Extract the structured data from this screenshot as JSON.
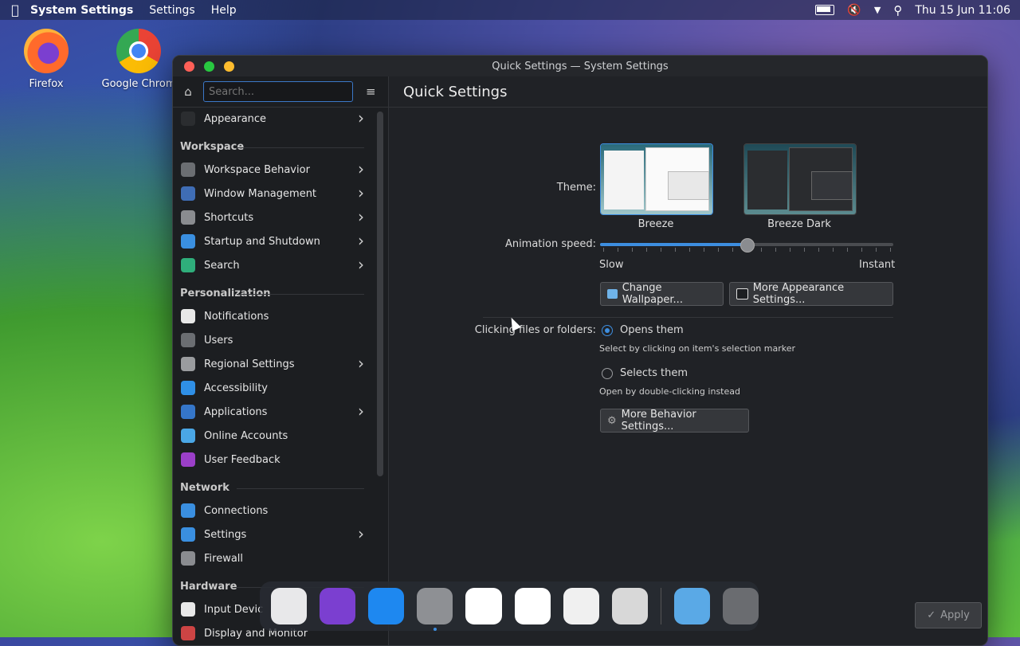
{
  "menubar": {
    "app_name": "System Settings",
    "menus": [
      "Settings",
      "Help"
    ],
    "datetime": "Thu 15 Jun 11:06"
  },
  "desktop": {
    "icons": [
      {
        "label": "Firefox"
      },
      {
        "label": "Google Chrom"
      }
    ]
  },
  "window": {
    "title": "Quick Settings — System Settings"
  },
  "sidebar": {
    "search_placeholder": "Search...",
    "items": [
      {
        "type": "item",
        "label": "Appearance",
        "chevron": true,
        "color": "#2b2d30"
      },
      {
        "type": "group",
        "label": "Workspace"
      },
      {
        "type": "item",
        "label": "Workspace Behavior",
        "chevron": true,
        "color": "#6b6e72"
      },
      {
        "type": "item",
        "label": "Window Management",
        "chevron": true,
        "color": "#3f6db5"
      },
      {
        "type": "item",
        "label": "Shortcuts",
        "chevron": true,
        "color": "#8a8c90"
      },
      {
        "type": "item",
        "label": "Startup and Shutdown",
        "chevron": true,
        "color": "#3a8fe0"
      },
      {
        "type": "item",
        "label": "Search",
        "chevron": true,
        "color": "#2fae7b"
      },
      {
        "type": "group",
        "label": "Personalization"
      },
      {
        "type": "item",
        "label": "Notifications",
        "chevron": false,
        "color": "#e8e8e8"
      },
      {
        "type": "item",
        "label": "Users",
        "chevron": false,
        "color": "#6b6e72"
      },
      {
        "type": "item",
        "label": "Regional Settings",
        "chevron": true,
        "color": "#9a9c9f"
      },
      {
        "type": "item",
        "label": "Accessibility",
        "chevron": false,
        "color": "#2f8fe6"
      },
      {
        "type": "item",
        "label": "Applications",
        "chevron": true,
        "color": "#3576c9"
      },
      {
        "type": "item",
        "label": "Online Accounts",
        "chevron": false,
        "color": "#4aa7e6"
      },
      {
        "type": "item",
        "label": "User Feedback",
        "chevron": false,
        "color": "#9b3fc8"
      },
      {
        "type": "group",
        "label": "Network"
      },
      {
        "type": "item",
        "label": "Connections",
        "chevron": false,
        "color": "#3a8fe0"
      },
      {
        "type": "item",
        "label": "Settings",
        "chevron": true,
        "color": "#3a8fe0"
      },
      {
        "type": "item",
        "label": "Firewall",
        "chevron": false,
        "color": "#8a8c90"
      },
      {
        "type": "group",
        "label": "Hardware"
      },
      {
        "type": "item",
        "label": "Input Devic",
        "chevron": false,
        "color": "#e8e8e8"
      },
      {
        "type": "item",
        "label": "Display and Monitor",
        "chevron": false,
        "color": "#c44"
      }
    ]
  },
  "content": {
    "heading": "Quick Settings",
    "theme_label": "Theme:",
    "themes": [
      {
        "name": "Breeze",
        "selected": true
      },
      {
        "name": "Breeze Dark",
        "selected": false
      }
    ],
    "animation_label": "Animation speed:",
    "animation_value_fraction": 0.5,
    "slow_label": "Slow",
    "instant_label": "Instant",
    "change_wallpaper": "Change Wallpaper...",
    "more_appearance": "More Appearance Settings...",
    "clicking_label": "Clicking files or folders:",
    "opens_them": "Opens them",
    "opens_hint": "Select by clicking on item's selection marker",
    "selects_them": "Selects them",
    "selects_hint": "Open by double-clicking instead",
    "selected_click_mode": "opens",
    "more_behavior": "More Behavior Settings...",
    "apply": "Apply"
  },
  "dock": {
    "apps": [
      {
        "name": "launchpad-icon",
        "color": "#e8e8ea"
      },
      {
        "name": "firefox-icon",
        "color": "#7b3fd0"
      },
      {
        "name": "app-store-icon",
        "color": "#1e88f0"
      },
      {
        "name": "system-settings-icon",
        "color": "#8e9094"
      },
      {
        "name": "writer-icon",
        "color": "#ffffff"
      },
      {
        "name": "calc-icon",
        "color": "#ffffff"
      },
      {
        "name": "draw-icon",
        "color": "#f0f0f0"
      },
      {
        "name": "calculator-icon",
        "color": "#d8d8d8"
      },
      {
        "name": "downloads-folder-icon",
        "color": "#5aa9e6"
      },
      {
        "name": "trash-icon",
        "color": "#6a6c70"
      }
    ],
    "accent": "#3d8ee0"
  }
}
